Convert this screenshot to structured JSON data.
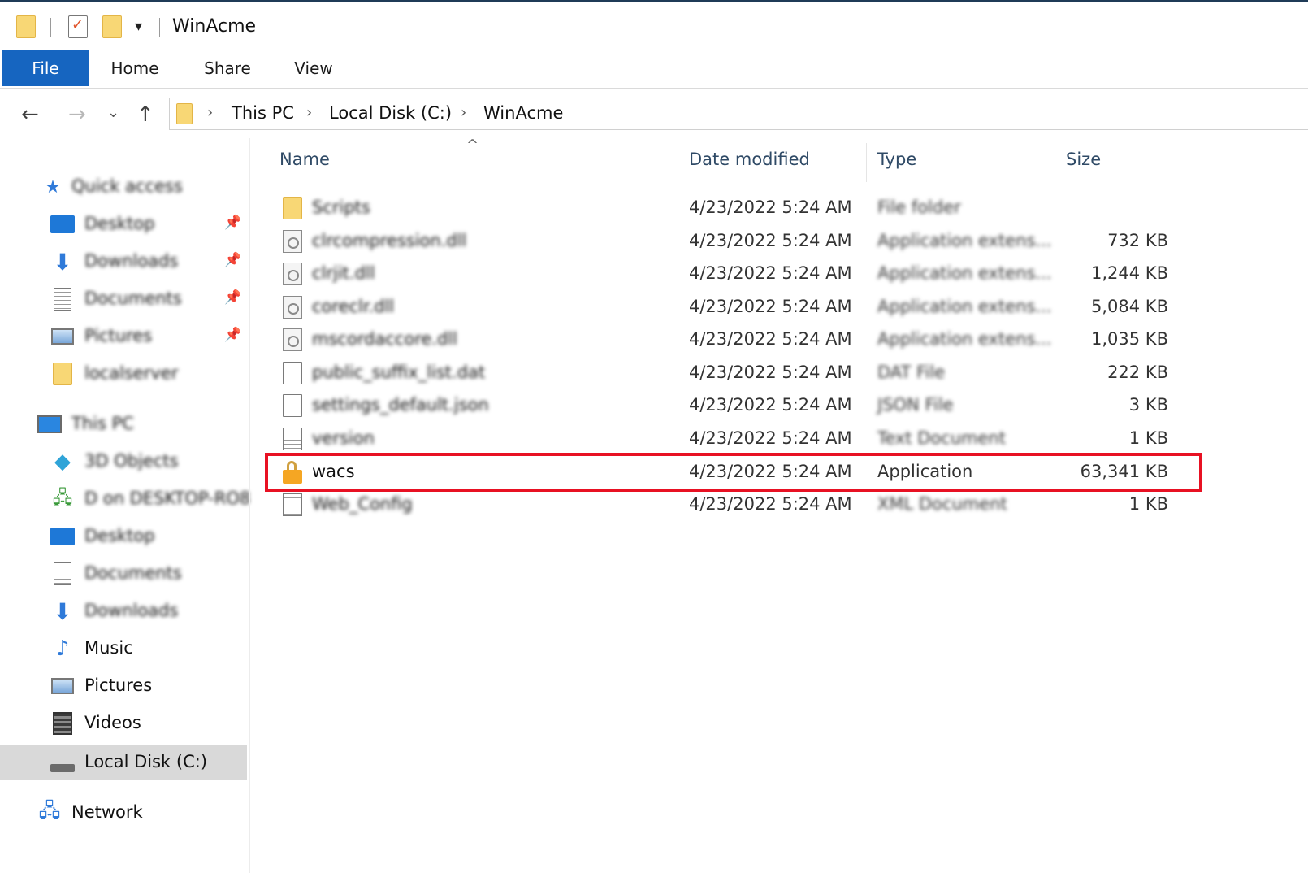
{
  "window": {
    "title": "WinAcme"
  },
  "ribbon": {
    "tabs": [
      "File",
      "Home",
      "Share",
      "View"
    ]
  },
  "address": {
    "crumbs": [
      "This PC",
      "Local Disk (C:)",
      "WinAcme"
    ]
  },
  "sidebar": {
    "quick_access": "Quick access",
    "quick_items": [
      "Desktop",
      "Downloads",
      "Documents",
      "Pictures",
      "localserver"
    ],
    "this_pc": "This PC",
    "pc_items": [
      "3D Objects",
      "D on DESKTOP-RO8",
      "Desktop",
      "Documents",
      "Downloads",
      "Music",
      "Pictures",
      "Videos",
      "Local Disk (C:)"
    ],
    "network": "Network"
  },
  "columns": {
    "name": "Name",
    "date": "Date modified",
    "type": "Type",
    "size": "Size"
  },
  "files": [
    {
      "name": "Scripts",
      "date": "4/23/2022 5:24 AM",
      "type": "File folder",
      "size": ""
    },
    {
      "name": "clrcompression.dll",
      "date": "4/23/2022 5:24 AM",
      "type": "Application extens...",
      "size": "732 KB"
    },
    {
      "name": "clrjit.dll",
      "date": "4/23/2022 5:24 AM",
      "type": "Application extens...",
      "size": "1,244 KB"
    },
    {
      "name": "coreclr.dll",
      "date": "4/23/2022 5:24 AM",
      "type": "Application extens...",
      "size": "5,084 KB"
    },
    {
      "name": "mscordaccore.dll",
      "date": "4/23/2022 5:24 AM",
      "type": "Application extens...",
      "size": "1,035 KB"
    },
    {
      "name": "public_suffix_list.dat",
      "date": "4/23/2022 5:24 AM",
      "type": "DAT File",
      "size": "222 KB"
    },
    {
      "name": "settings_default.json",
      "date": "4/23/2022 5:24 AM",
      "type": "JSON File",
      "size": "3 KB"
    },
    {
      "name": "version",
      "date": "4/23/2022 5:24 AM",
      "type": "Text Document",
      "size": "1 KB"
    },
    {
      "name": "wacs",
      "date": "4/23/2022 5:24 AM",
      "type": "Application",
      "size": "63,341 KB"
    },
    {
      "name": "Web_Config",
      "date": "4/23/2022 5:24 AM",
      "type": "XML Document",
      "size": "1 KB"
    }
  ],
  "colors": {
    "accent": "#1665c0",
    "highlight": "#e81123",
    "folder": "#f8d775"
  }
}
